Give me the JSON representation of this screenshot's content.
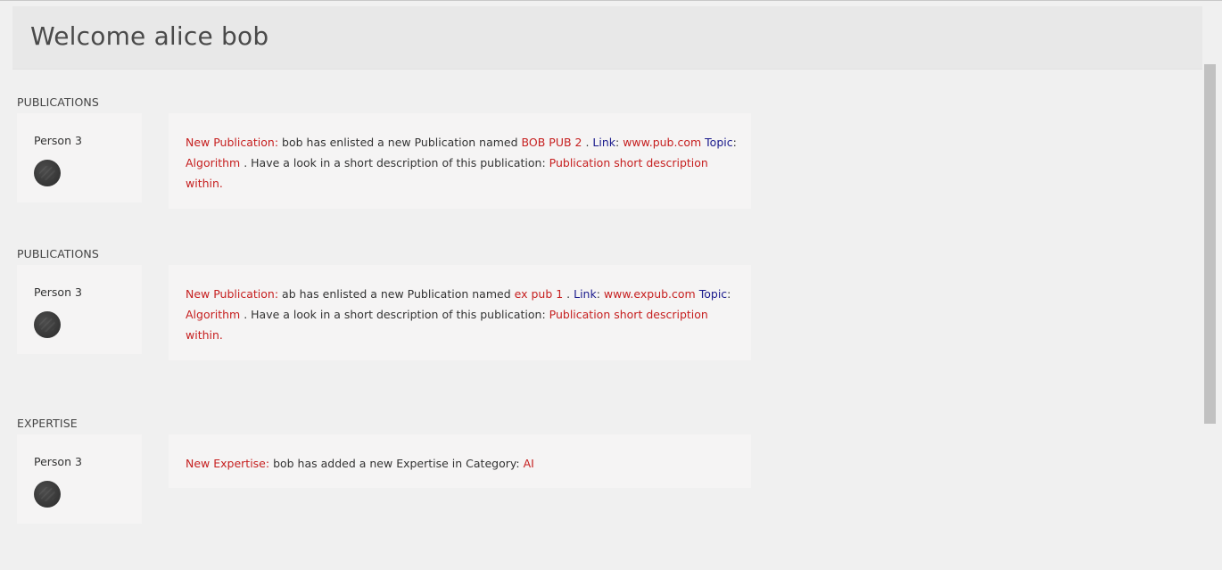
{
  "header": {
    "title": "Welcome alice bob"
  },
  "feed": [
    {
      "section": "PUBLICATIONS",
      "person": "Person 3",
      "type_label": "New Publication",
      "colon": ":",
      "actor_text": " bob has enlisted a new Publication named ",
      "item_name": "BOB PUB 2",
      "dot": " . ",
      "link_label": "Link",
      "link_value": "www.pub.com",
      "topic_label": "Topic",
      "topic_value": "Algorithm",
      "desc_text": " . Have a look in a short description of this publication: ",
      "desc_value": "Publication short description within."
    },
    {
      "section": "PUBLICATIONS",
      "person": "Person 3",
      "type_label": "New Publication",
      "colon": ":",
      "actor_text": " ab has enlisted a new Publication named ",
      "item_name": "ex pub 1",
      "dot": " . ",
      "link_label": "Link",
      "link_value": "www.expub.com",
      "topic_label": "Topic",
      "topic_value": "Algorithm",
      "desc_text": " . Have a look in a short description of this publication: ",
      "desc_value": "Publication short description within."
    },
    {
      "section": "EXPERTISE",
      "person": "Person 3",
      "type_label": "New Expertise",
      "colon": ":",
      "actor_text": " bob has added a new Expertise in Category: ",
      "category_value": "AI"
    }
  ]
}
